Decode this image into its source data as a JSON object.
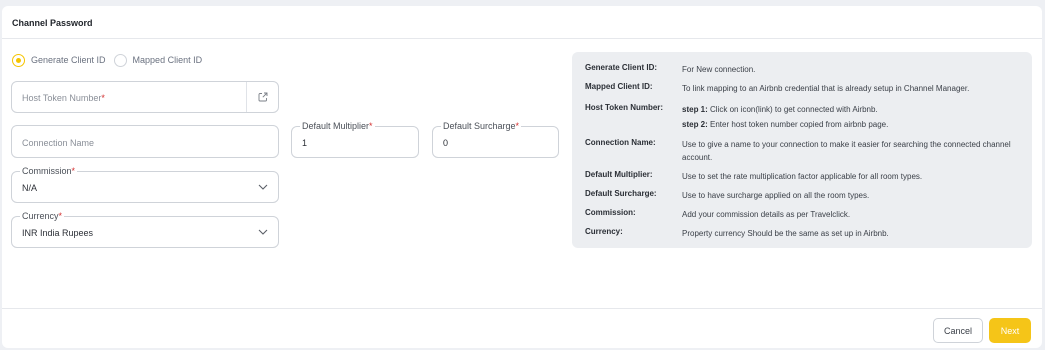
{
  "header": {
    "title": "Channel Password"
  },
  "mode": {
    "options": [
      "Generate Client ID",
      "Mapped Client ID"
    ],
    "selected": "Generate Client ID"
  },
  "form": {
    "host_token": {
      "placeholder": "Host Token Number",
      "required_mark": "*"
    },
    "connection_name": {
      "placeholder": "Connection Name"
    },
    "default_multiplier": {
      "label": "Default Multiplier",
      "required_mark": "*",
      "value": "1"
    },
    "default_surcharge": {
      "label": "Default Surcharge",
      "required_mark": "*",
      "value": "0"
    },
    "commission": {
      "label": "Commission",
      "required_mark": "*",
      "value": "N/A"
    },
    "currency": {
      "label": "Currency",
      "required_mark": "*",
      "value": "INR India Rupees"
    }
  },
  "help": {
    "generate_client_id": {
      "key": "Generate Client ID:",
      "text": "For New connection."
    },
    "mapped_client_id": {
      "key": "Mapped Client ID:",
      "text": "To link mapping to an Airbnb credential that is already setup in Channel Manager."
    },
    "host_token_number": {
      "key": "Host Token Number:",
      "step1_label": "step 1:",
      "step1_text": " Click on icon(link) to get connected with Airbnb.",
      "step2_label": "step 2:",
      "step2_text": " Enter host token number copied from airbnb page."
    },
    "connection_name": {
      "key": "Connection Name:",
      "text": "Use to give a name to your connection to make it easier for searching the connected channel account."
    },
    "default_multiplier": {
      "key": "Default Multiplier:",
      "text": "Use to set the rate multiplication factor applicable for all room types."
    },
    "default_surcharge": {
      "key": "Default Surcharge:",
      "text": "Use to have surcharge applied on all the room types."
    },
    "commission": {
      "key": "Commission:",
      "text": "Add your commission details as per Travelclick."
    },
    "currency": {
      "key": "Currency:",
      "text": "Property currency Should be the same as set up in Airbnb."
    }
  },
  "footer": {
    "cancel_label": "Cancel",
    "next_label": "Next"
  },
  "colors": {
    "accent": "#f5c518",
    "required": "#d32f2f",
    "info_bg": "#eceef1"
  },
  "icons": {
    "link": "external-link-icon",
    "dropdown": "chevron-down-icon"
  }
}
